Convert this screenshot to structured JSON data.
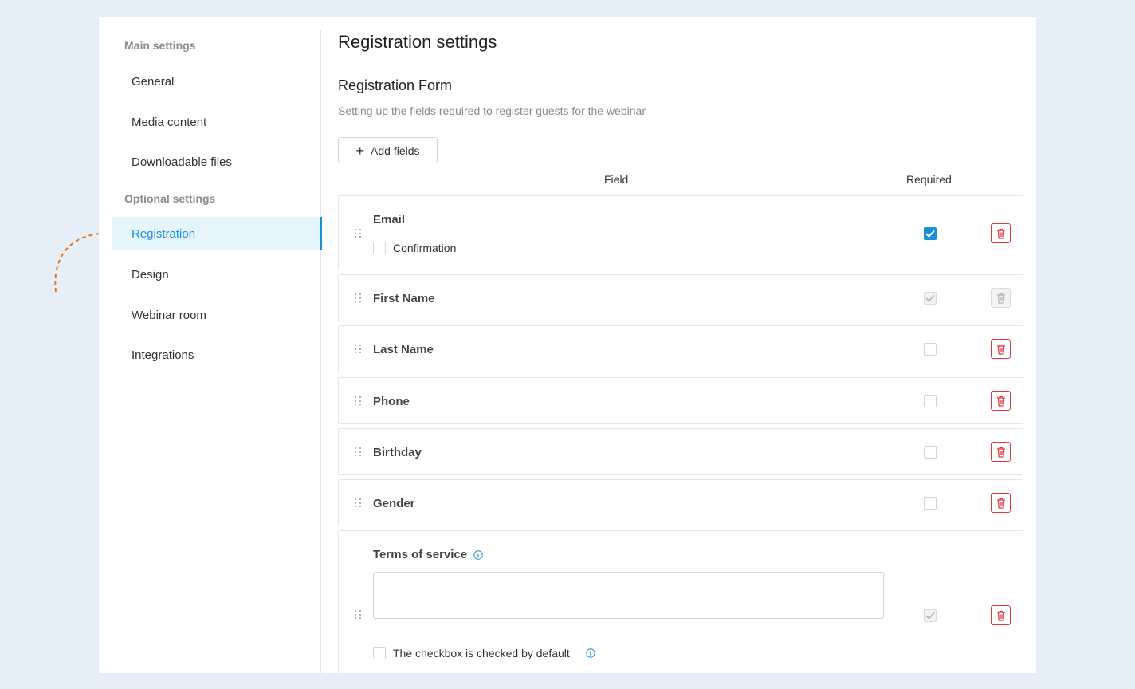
{
  "sidebar": {
    "main_title": "Main settings",
    "optional_title": "Optional settings",
    "main_items": [
      {
        "label": "General"
      },
      {
        "label": "Media content"
      },
      {
        "label": "Downloadable files"
      }
    ],
    "optional_items": [
      {
        "label": "Registration",
        "active": true
      },
      {
        "label": "Design"
      },
      {
        "label": "Webinar room"
      },
      {
        "label": "Integrations"
      }
    ]
  },
  "main": {
    "title": "Registration settings",
    "form_title": "Registration Form",
    "form_subtitle": "Setting up the fields required to register guests for the webinar",
    "add_fields_label": "Add fields",
    "col_field": "Field",
    "col_required": "Required",
    "fields": [
      {
        "label": "Email",
        "required": true,
        "sub_label": "Confirmation",
        "sub_checked": false
      },
      {
        "label": "First Name",
        "required": true,
        "locked": true
      },
      {
        "label": "Last Name",
        "required": false
      },
      {
        "label": "Phone",
        "required": false
      },
      {
        "label": "Birthday",
        "required": false
      },
      {
        "label": "Gender",
        "required": false
      }
    ],
    "terms": {
      "label": "Terms of service",
      "text_value": "",
      "checkbox_label": "The checkbox is checked by default",
      "checkbox_checked": false,
      "required": true,
      "required_disabled": true
    }
  },
  "colors": {
    "accent": "#1a8fd9",
    "danger": "#e0383e",
    "annotation_arrow": "#e8781e",
    "background": "#e6eef8"
  }
}
